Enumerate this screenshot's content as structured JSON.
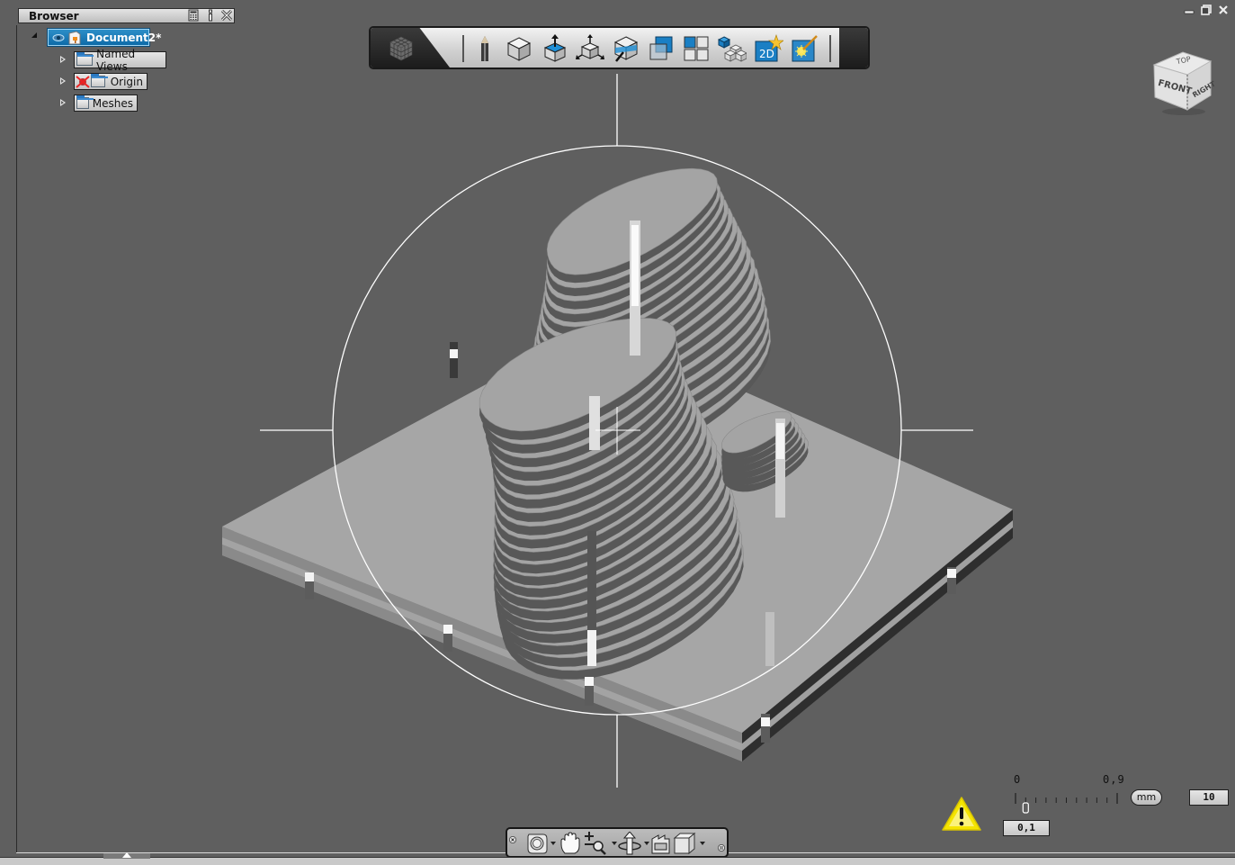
{
  "browser": {
    "title": "Browser",
    "header_buttons": [
      "calculator-icon",
      "info-icon",
      "close-icon"
    ],
    "tree": [
      {
        "label": "Document2*",
        "expanded": true,
        "selected": true,
        "icons": [
          "eye-icon",
          "document-icon"
        ]
      },
      {
        "label": "Named Views",
        "expanded": false,
        "icons": [
          "folder-icon"
        ]
      },
      {
        "label": "Origin",
        "expanded": false,
        "icons": [
          "visibility-off-icon",
          "folder-icon"
        ]
      },
      {
        "label": "Meshes",
        "expanded": false,
        "icons": [
          "folder-icon"
        ]
      }
    ]
  },
  "toolbar": {
    "tools": [
      {
        "name": "app-menu-cube",
        "icon": "rubik-cube-icon"
      },
      {
        "name": "sketch",
        "icon": "pencil-icon"
      },
      {
        "name": "primitive",
        "icon": "cube-icon"
      },
      {
        "name": "extrude",
        "icon": "push-pull-icon"
      },
      {
        "name": "move",
        "icon": "move-arrows-icon"
      },
      {
        "name": "section",
        "icon": "section-cut-icon"
      },
      {
        "name": "view-overlap",
        "icon": "overlap-squares-icon"
      },
      {
        "name": "layout",
        "icon": "four-panel-icon"
      },
      {
        "name": "pattern",
        "icon": "cube-array-icon"
      },
      {
        "name": "2d-view",
        "icon": "2d-star-icon",
        "label": "2D"
      },
      {
        "name": "render",
        "icon": "magic-wand-icon"
      }
    ]
  },
  "window_controls": {
    "minimize": "—",
    "restore": "❐",
    "close": "✕"
  },
  "viewcube": {
    "faces": {
      "top": "TOP",
      "front": "FRONT",
      "right": "RIGHT"
    }
  },
  "navbar": {
    "tools": [
      {
        "name": "steering-wheel",
        "icon": "steering-wheel-icon",
        "dropdown": true
      },
      {
        "name": "pan",
        "icon": "hand-icon",
        "dropdown": false
      },
      {
        "name": "zoom",
        "icon": "zoom-icon",
        "dropdown": true
      },
      {
        "name": "orbit",
        "icon": "orbit-icon",
        "dropdown": true
      },
      {
        "name": "look-at",
        "icon": "look-at-icon",
        "dropdown": false
      },
      {
        "name": "view-cube",
        "icon": "box-view-icon",
        "dropdown": true
      }
    ]
  },
  "scale": {
    "min_label": "0",
    "max_label": "0,9",
    "unit": "mm",
    "current_value": "0,1",
    "current_fraction": 0.1,
    "grid_value": "10",
    "warning_icon": "warning-icon"
  },
  "colors": {
    "viewport_bg": "#5f5f5f",
    "model_face": "#a5a5a5",
    "model_side_dark": "#5a5a5a",
    "selection_blue": "#0d6ba8",
    "warning_yellow": "#f5e400"
  }
}
